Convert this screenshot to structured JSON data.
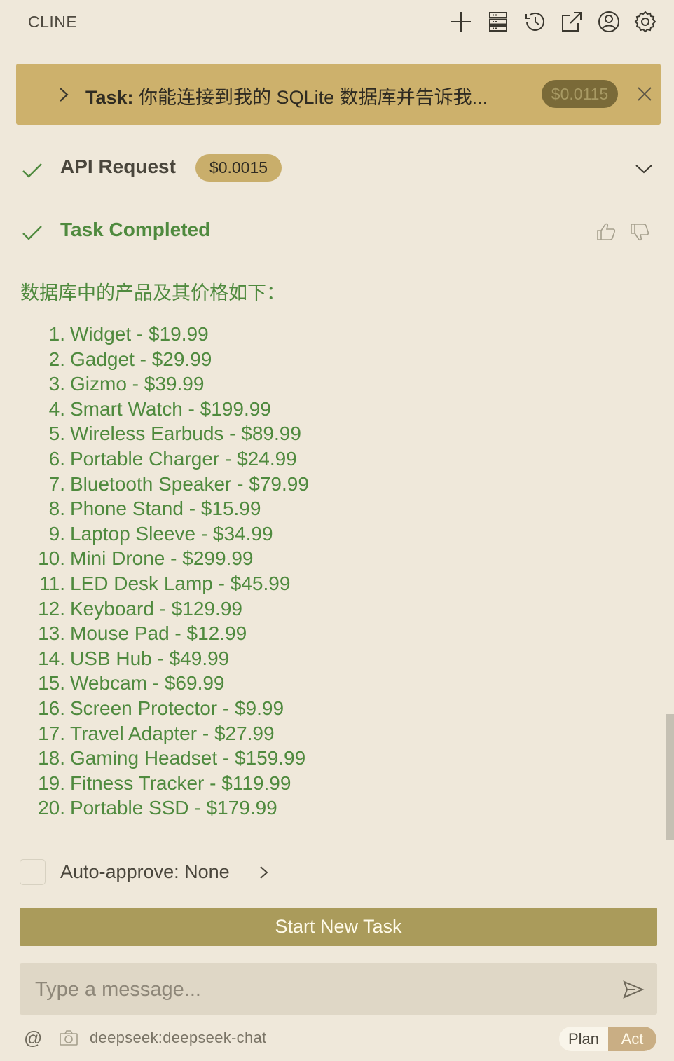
{
  "header": {
    "app_title": "CLINE",
    "icons": [
      "plus-icon",
      "server-icon",
      "history-icon",
      "popout-icon",
      "account-icon",
      "gear-icon"
    ]
  },
  "task": {
    "label": "Task:",
    "text": "你能连接到我的 SQLite 数据库并告诉我...",
    "cost": "$0.0115"
  },
  "api_request": {
    "title": "API Request",
    "cost": "$0.0015"
  },
  "completion": {
    "title": "Task Completed",
    "intro": "数据库中的产品及其价格如下：",
    "products": [
      {
        "num": "1.",
        "text": "Widget - $19.99"
      },
      {
        "num": "2.",
        "text": "Gadget - $29.99"
      },
      {
        "num": "3.",
        "text": "Gizmo - $39.99"
      },
      {
        "num": "4.",
        "text": "Smart Watch - $199.99"
      },
      {
        "num": "5.",
        "text": "Wireless Earbuds - $89.99"
      },
      {
        "num": "6.",
        "text": "Portable Charger - $24.99"
      },
      {
        "num": "7.",
        "text": "Bluetooth Speaker - $79.99"
      },
      {
        "num": "8.",
        "text": "Phone Stand - $15.99"
      },
      {
        "num": "9.",
        "text": "Laptop Sleeve - $34.99"
      },
      {
        "num": "10.",
        "text": "Mini Drone - $299.99"
      },
      {
        "num": "11.",
        "text": "LED Desk Lamp - $45.99"
      },
      {
        "num": "12.",
        "text": "Keyboard - $129.99"
      },
      {
        "num": "13.",
        "text": "Mouse Pad - $12.99"
      },
      {
        "num": "14.",
        "text": "USB Hub - $49.99"
      },
      {
        "num": "15.",
        "text": "Webcam - $69.99"
      },
      {
        "num": "16.",
        "text": "Screen Protector - $9.99"
      },
      {
        "num": "17.",
        "text": "Travel Adapter - $27.99"
      },
      {
        "num": "18.",
        "text": "Gaming Headset - $159.99"
      },
      {
        "num": "19.",
        "text": "Fitness Tracker - $119.99"
      },
      {
        "num": "20.",
        "text": "Portable SSD - $179.99"
      }
    ]
  },
  "auto_approve": {
    "label": "Auto-approve: None",
    "checked": false
  },
  "start_new_task": "Start New Task",
  "input": {
    "placeholder": "Type a message...",
    "value": ""
  },
  "footer": {
    "at": "@",
    "model": "deepseek:deepseek-chat",
    "mode_plan": "Plan",
    "mode_act": "Act",
    "active_mode": "Act"
  },
  "colors": {
    "background": "#efe8da",
    "task_banner": "#cdb16c",
    "success_green": "#4f8a3e",
    "primary_button": "#aa9b5b",
    "act_active": "#c9ae84"
  }
}
